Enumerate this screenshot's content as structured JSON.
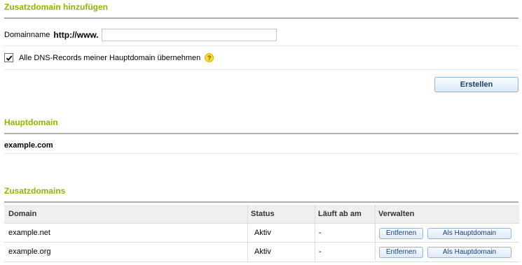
{
  "add_section": {
    "title": "Zusatzdomain hinzufügen",
    "domain_label": "Domainname",
    "domain_prefix": "http://www.",
    "domain_value": "",
    "checkbox_label": "Alle DNS-Records meiner Hauptdomain übernehmen",
    "checkbox_checked": true,
    "help_icon": "?",
    "create_button": "Erstellen"
  },
  "main_section": {
    "title": "Hauptdomain",
    "domain": "example.com"
  },
  "addon_section": {
    "title": "Zusatzdomains",
    "columns": [
      "Domain",
      "Status",
      "Läuft ab am",
      "Verwalten"
    ],
    "rows": [
      {
        "domain": "example.net",
        "status": "Aktiv",
        "expires": "-",
        "remove": "Entfernen",
        "make_main": "Als Hauptdomain"
      },
      {
        "domain": "example.org",
        "status": "Aktiv",
        "expires": "-",
        "remove": "Entfernen",
        "make_main": "Als Hauptdomain"
      }
    ]
  },
  "colors": {
    "accent": "#8db600",
    "button_text": "#1b3f78"
  }
}
